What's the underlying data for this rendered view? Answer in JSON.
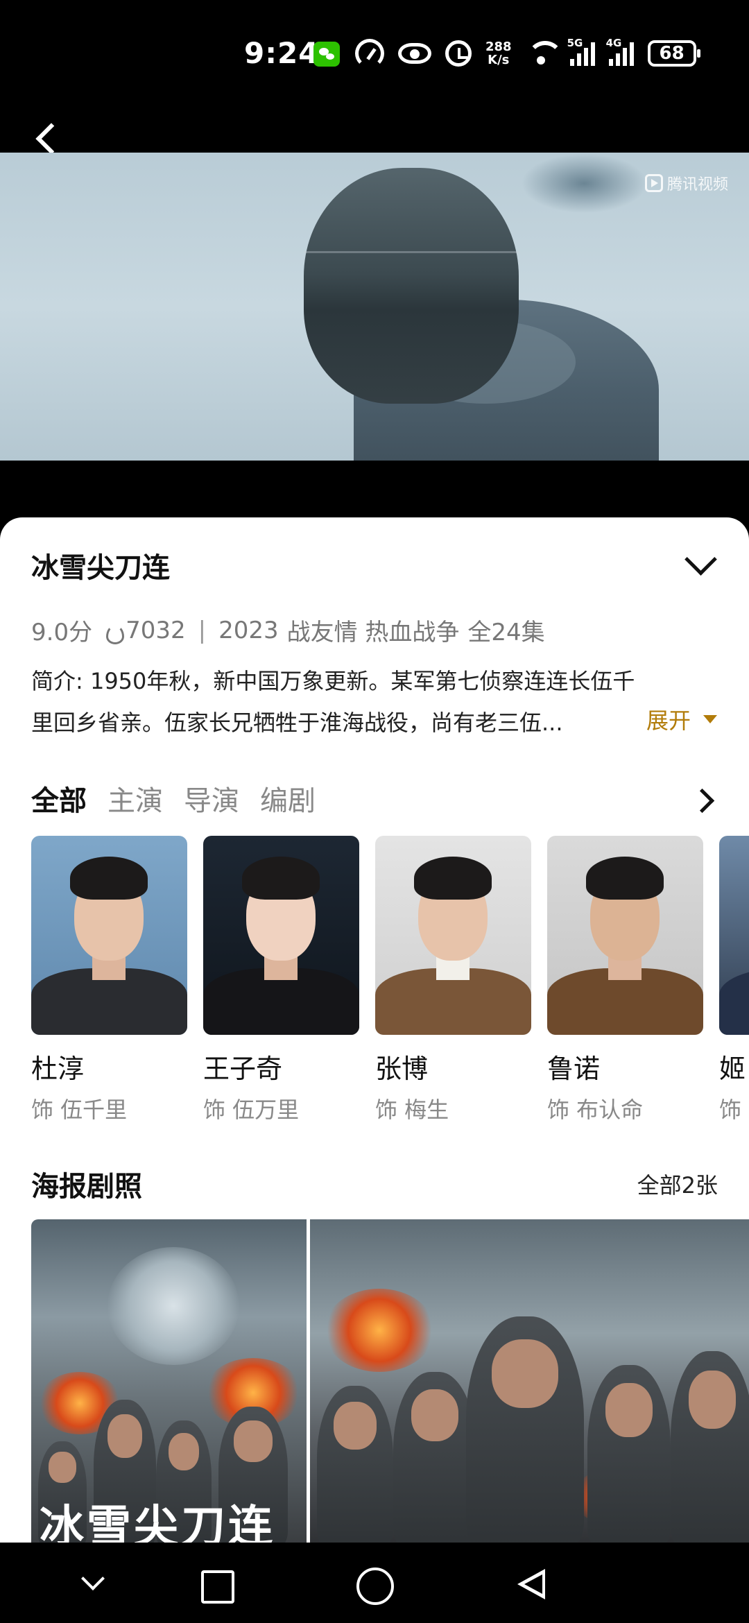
{
  "status_bar": {
    "time": "9:24",
    "net_speed_top": "288",
    "net_speed_bottom": "K/s",
    "sig1_label": "5G",
    "sig2_label": "4G",
    "battery": "68",
    "icons": [
      "wechat-icon",
      "speedometer-icon",
      "eye-icon",
      "alarm-icon",
      "wifi-icon",
      "signal-icon",
      "battery-icon"
    ]
  },
  "video": {
    "watermark": "腾讯视频"
  },
  "show": {
    "title": "冰雪尖刀连",
    "score": "9.0分",
    "heat": "7032",
    "separator": "|",
    "year": "2023",
    "tags": "战友情 热血战争",
    "episodes": "全24集",
    "intro_line1": "简介: 1950年秋，新中国万象更新。某军第七侦察连连长伍千",
    "intro_line2": "里回乡省亲。伍家长兄牺牲于淮海战役，尚有老三伍...",
    "expand_label": "展开"
  },
  "tabs": [
    {
      "label": "全部",
      "active": true
    },
    {
      "label": "主演",
      "active": false
    },
    {
      "label": "导演",
      "active": false
    },
    {
      "label": "编剧",
      "active": false
    }
  ],
  "cast": [
    {
      "name": "杜淳",
      "role": "饰 伍千里"
    },
    {
      "name": "王子奇",
      "role": "饰 伍万里"
    },
    {
      "name": "张博",
      "role": "饰 梅生"
    },
    {
      "name": "鲁诺",
      "role": "饰 布认命"
    },
    {
      "name": "姬",
      "role": "饰"
    }
  ],
  "posters": {
    "title": "海报剧照",
    "more_label": "全部2张",
    "poster_text": "冰雪尖刀连"
  },
  "colors": {
    "accent": "#b27c0a",
    "text_primary": "#111111",
    "text_secondary": "#888888"
  }
}
